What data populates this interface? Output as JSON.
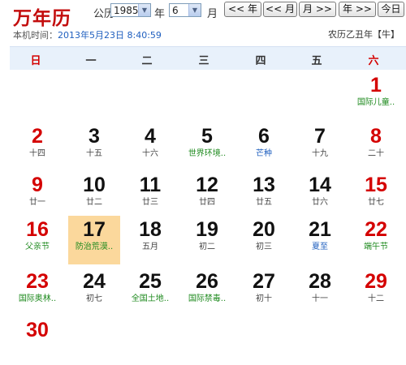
{
  "header": {
    "logo": "万年历",
    "calendar_label": "公历",
    "year_value": "1985",
    "year_label": "年",
    "month_value": "6",
    "month_label": "月",
    "buttons": [
      "<< 年",
      "<< 月",
      "月 >>",
      "年 >>",
      "今日"
    ],
    "local_time_label": "本机时间：",
    "local_time_value": "2013年5月23日 8:40:59",
    "lunar_year": "农历乙丑年【牛】"
  },
  "weekdays": [
    "日",
    "一",
    "二",
    "三",
    "四",
    "五",
    "六"
  ],
  "rows": [
    [
      null,
      null,
      null,
      null,
      null,
      null,
      {
        "day": "1",
        "sub": "国际儿童..",
        "sub_color": "green",
        "weekend": true
      }
    ],
    [
      {
        "day": "2",
        "sub": "十四",
        "weekend": true
      },
      {
        "day": "3",
        "sub": "十五"
      },
      {
        "day": "4",
        "sub": "十六"
      },
      {
        "day": "5",
        "sub": "世界环境..",
        "sub_color": "green"
      },
      {
        "day": "6",
        "sub": "芒种",
        "sub_color": "blue"
      },
      {
        "day": "7",
        "sub": "十九"
      },
      {
        "day": "8",
        "sub": "二十",
        "weekend": true
      }
    ],
    [
      {
        "day": "9",
        "sub": "廿一",
        "weekend": true
      },
      {
        "day": "10",
        "sub": "廿二"
      },
      {
        "day": "11",
        "sub": "廿三"
      },
      {
        "day": "12",
        "sub": "廿四"
      },
      {
        "day": "13",
        "sub": "廿五"
      },
      {
        "day": "14",
        "sub": "廿六"
      },
      {
        "day": "15",
        "sub": "廿七",
        "weekend": true
      }
    ],
    [
      {
        "day": "16",
        "sub": "父亲节",
        "sub_color": "green",
        "weekend": true
      },
      {
        "day": "17",
        "sub": "防治荒漠..",
        "sub_color": "green",
        "today": true
      },
      {
        "day": "18",
        "sub": "五月"
      },
      {
        "day": "19",
        "sub": "初二"
      },
      {
        "day": "20",
        "sub": "初三"
      },
      {
        "day": "21",
        "sub": "夏至",
        "sub_color": "blue"
      },
      {
        "day": "22",
        "sub": "端午节",
        "sub_color": "green",
        "weekend": true
      }
    ],
    [
      {
        "day": "23",
        "sub": "国际奥林..",
        "sub_color": "green",
        "weekend": true
      },
      {
        "day": "24",
        "sub": "初七"
      },
      {
        "day": "25",
        "sub": "全国土地..",
        "sub_color": "green"
      },
      {
        "day": "26",
        "sub": "国际禁毒..",
        "sub_color": "green"
      },
      {
        "day": "27",
        "sub": "初十"
      },
      {
        "day": "28",
        "sub": "十一"
      },
      {
        "day": "29",
        "sub": "十二",
        "weekend": true
      }
    ],
    [
      {
        "day": "30",
        "sub": "",
        "weekend": true
      },
      null,
      null,
      null,
      null,
      null,
      null
    ]
  ]
}
